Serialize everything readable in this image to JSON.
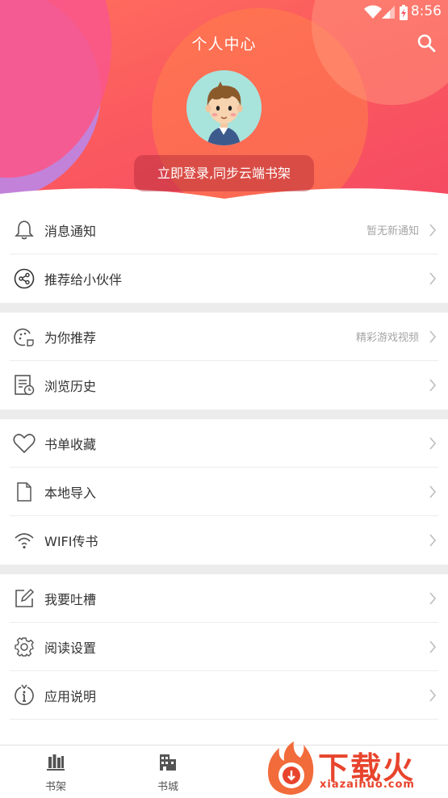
{
  "status_bar": {
    "time": "8:56"
  },
  "header": {
    "title": "个人中心",
    "login_label": "立即登录,同步云端书架"
  },
  "menu": {
    "group1": [
      {
        "label": "消息通知",
        "hint": "暂无新通知",
        "icon": "bell-icon"
      },
      {
        "label": "推荐给小伙伴",
        "hint": "",
        "icon": "share-icon"
      }
    ],
    "group2": [
      {
        "label": "为你推荐",
        "hint": "精彩游戏视频",
        "icon": "recommend-icon"
      },
      {
        "label": "浏览历史",
        "hint": "",
        "icon": "history-icon"
      }
    ],
    "group3": [
      {
        "label": "书单收藏",
        "hint": "",
        "icon": "heart-icon"
      },
      {
        "label": "本地导入",
        "hint": "",
        "icon": "file-icon"
      },
      {
        "label": "WIFI传书",
        "hint": "",
        "icon": "wifi-icon"
      }
    ],
    "group4": [
      {
        "label": "我要吐槽",
        "hint": "",
        "icon": "edit-icon"
      },
      {
        "label": "阅读设置",
        "hint": "",
        "icon": "gear-icon"
      },
      {
        "label": "应用说明",
        "hint": "",
        "icon": "info-icon"
      }
    ]
  },
  "bottom_nav": {
    "items": [
      {
        "label": "书架",
        "icon": "bookshelf-icon"
      },
      {
        "label": "书城",
        "icon": "bookstore-icon"
      }
    ]
  },
  "watermark": {
    "title": "下载火",
    "url": "xiazaihuo.com"
  },
  "colors": {
    "header_start": "#ff6f5d",
    "header_end": "#f54a63",
    "accent": "#e8442d"
  }
}
